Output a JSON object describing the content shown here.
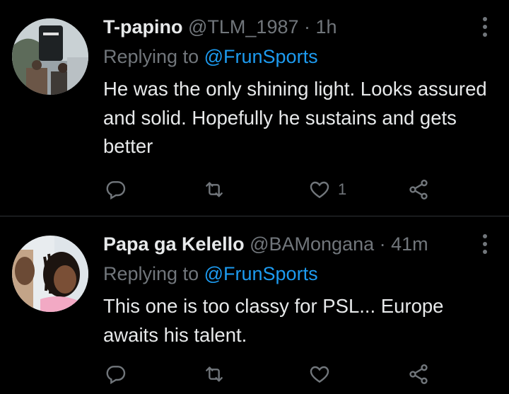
{
  "tweets": [
    {
      "display_name": "T-papino",
      "handle": "@TLM_1987",
      "separator": "·",
      "time": "1h",
      "replying_prefix": "Replying to",
      "replying_to": "@FrunSports",
      "text": "He was the only shining light. Looks assured and solid. Hopefully he sustains and gets better",
      "like_count": "1",
      "avatar_icon": "profile-photo-jersey"
    },
    {
      "display_name": "Papa ga Kelello",
      "handle": "@BAMongana",
      "separator": "·",
      "time": "41m",
      "replying_prefix": "Replying to",
      "replying_to": "@FrunSports",
      "text": "This one is too classy for PSL... Europe awaits his talent.",
      "like_count": "",
      "avatar_icon": "profile-photo-girl"
    }
  ],
  "icons": {
    "reply": "reply-icon",
    "retweet": "retweet-icon",
    "like": "heart-icon",
    "share": "share-icon",
    "more": "more-icon"
  },
  "colors": {
    "background": "#000000",
    "text": "#e7e9ea",
    "muted": "#71767b",
    "link": "#1d9bf0",
    "divider": "#2f3336"
  }
}
